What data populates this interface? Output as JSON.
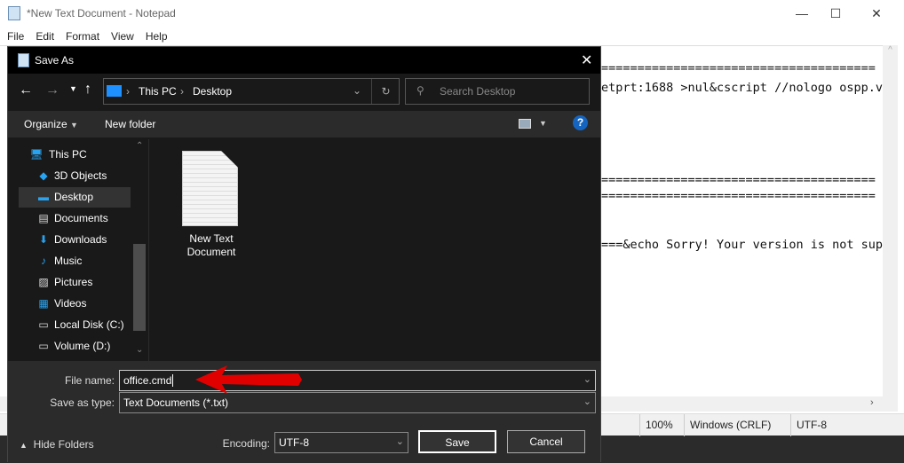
{
  "notepad": {
    "title": "*New Text Document - Notepad",
    "menu": [
      "File",
      "Edit",
      "Format",
      "View",
      "Help"
    ],
    "lines": [
      "======================================",
      "etprt:1688 >nul&cscript //nologo ospp.v",
      "======================================",
      "======================================",
      "===&echo Sorry! Your version is not sup"
    ],
    "status": {
      "zoom": "100%",
      "eol": "Windows (CRLF)",
      "encoding": "UTF-8"
    }
  },
  "dialog": {
    "title": "Save As",
    "breadcrumb": [
      "This PC",
      "Desktop"
    ],
    "search_placeholder": "Search Desktop",
    "toolbar": {
      "organize": "Organize",
      "new_folder": "New folder"
    },
    "sidebar": [
      {
        "label": "This PC",
        "icon": "computer-icon"
      },
      {
        "label": "3D Objects",
        "icon": "cube-icon"
      },
      {
        "label": "Desktop",
        "icon": "desktop-icon",
        "selected": true
      },
      {
        "label": "Documents",
        "icon": "document-icon"
      },
      {
        "label": "Downloads",
        "icon": "download-icon"
      },
      {
        "label": "Music",
        "icon": "music-icon"
      },
      {
        "label": "Pictures",
        "icon": "picture-icon"
      },
      {
        "label": "Videos",
        "icon": "video-icon"
      },
      {
        "label": "Local Disk (C:)",
        "icon": "drive-icon"
      },
      {
        "label": "Volume (D:)",
        "icon": "drive-icon"
      }
    ],
    "files": [
      {
        "line1": "New Text",
        "line2": "Document"
      }
    ],
    "file_name_label": "File name:",
    "file_name": "office.cmd",
    "save_type_label": "Save as type:",
    "save_type": "Text Documents (*.txt)",
    "hide_folders": "Hide Folders",
    "encoding_label": "Encoding:",
    "encoding": "UTF-8",
    "save": "Save",
    "cancel": "Cancel"
  },
  "colors": {
    "accent": "#0a84ff",
    "arrow": "#e00000"
  }
}
